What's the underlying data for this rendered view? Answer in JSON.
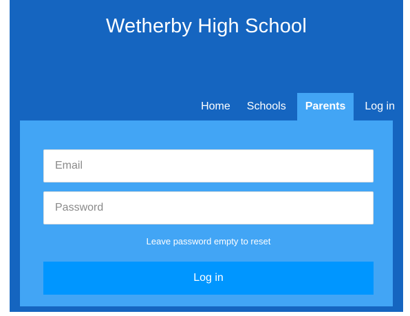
{
  "header": {
    "title": "Wetherby High School"
  },
  "nav": {
    "items": [
      {
        "label": "Home"
      },
      {
        "label": "Schools"
      },
      {
        "label": "Parents"
      },
      {
        "label": "Log in"
      }
    ],
    "active": "Parents"
  },
  "login_form": {
    "email": {
      "placeholder": "Email",
      "value": ""
    },
    "password": {
      "placeholder": "Password",
      "value": ""
    },
    "hint": "Leave password empty to reset",
    "submit_label": "Log in"
  },
  "colors": {
    "header_bg": "#1565c0",
    "panel_bg": "#42a5f5",
    "button_bg": "#0096ff",
    "text": "#ffffff"
  }
}
